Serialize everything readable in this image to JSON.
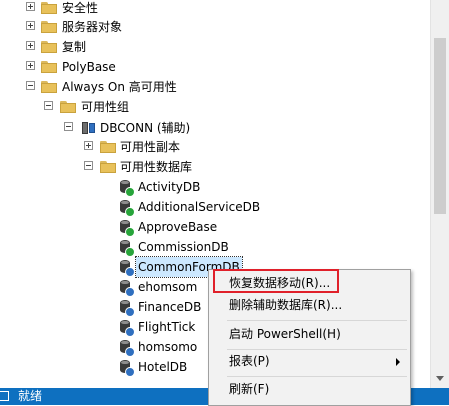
{
  "tree": {
    "items": [
      {
        "label": "安全性"
      },
      {
        "label": "服务器对象"
      },
      {
        "label": "复制"
      },
      {
        "label": "PolyBase"
      },
      {
        "label": "Always On 高可用性"
      },
      {
        "label": "可用性组"
      },
      {
        "label": "DBCONN (辅助)"
      },
      {
        "label": "可用性副本"
      },
      {
        "label": "可用性数据库"
      },
      {
        "label": "ActivityDB"
      },
      {
        "label": "AdditionalServiceDB"
      },
      {
        "label": "ApproveBase"
      },
      {
        "label": "CommissionDB"
      },
      {
        "label": "CommonFormDB"
      },
      {
        "label": "ehomsom"
      },
      {
        "label": "FinanceDB"
      },
      {
        "label": "FlightTick"
      },
      {
        "label": "homsomo"
      },
      {
        "label": "HotelDB"
      }
    ]
  },
  "context_menu": {
    "items": [
      {
        "label": "恢复数据移动(R)..."
      },
      {
        "label": "删除辅助数据库(R)..."
      },
      {
        "label": "启动 PowerShell(H)"
      },
      {
        "label": "报表(P)"
      },
      {
        "label": "刷新(F)"
      }
    ]
  },
  "status": {
    "text": "就绪"
  },
  "colors": {
    "status_bar": "#0e70c0",
    "highlight_box": "#e0202a",
    "selection": "#cce8ff"
  }
}
